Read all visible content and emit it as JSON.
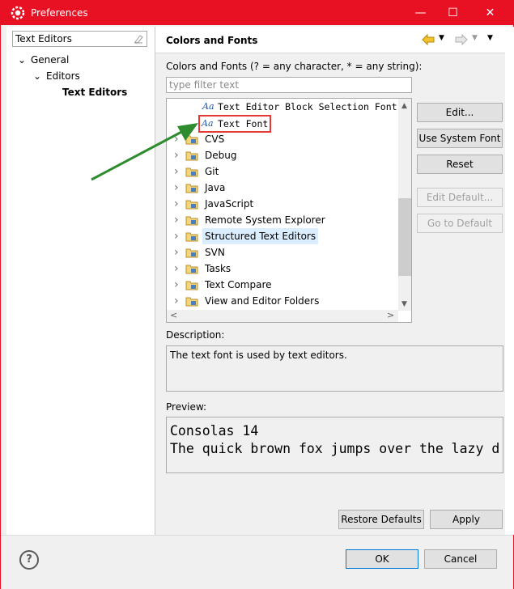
{
  "window": {
    "title": "Preferences",
    "accent": "#e81123"
  },
  "left": {
    "filter_value": "Text Editors",
    "tree": [
      {
        "label": "General",
        "level": 0,
        "expanded": true
      },
      {
        "label": "Editors",
        "level": 1,
        "expanded": true
      },
      {
        "label": "Text Editors",
        "level": 2,
        "selected": true
      }
    ]
  },
  "page": {
    "title": "Colors and Fonts",
    "filter_label": "Colors and Fonts (? = any character, * = any string):",
    "filter_placeholder": "type filter text",
    "tree_items": [
      {
        "label": "Text Editor Block Selection Font",
        "type": "font"
      },
      {
        "label": "Text Font",
        "type": "font",
        "highlighted": true
      },
      {
        "label": "CVS",
        "type": "folder"
      },
      {
        "label": "Debug",
        "type": "folder"
      },
      {
        "label": "Git",
        "type": "folder"
      },
      {
        "label": "Java",
        "type": "folder"
      },
      {
        "label": "JavaScript",
        "type": "folder"
      },
      {
        "label": "Remote System Explorer",
        "type": "folder"
      },
      {
        "label": "Structured Text Editors",
        "type": "folder",
        "hovered": true
      },
      {
        "label": "SVN",
        "type": "folder"
      },
      {
        "label": "Tasks",
        "type": "folder"
      },
      {
        "label": "Text Compare",
        "type": "folder"
      },
      {
        "label": "View and Editor Folders",
        "type": "folder"
      }
    ],
    "buttons": {
      "edit": "Edit...",
      "use_system_font": "Use System Font",
      "reset": "Reset",
      "edit_default": "Edit Default...",
      "go_to_default": "Go to Default"
    },
    "description_label": "Description:",
    "description_text": "The text font is used by text editors.",
    "preview_label": "Preview:",
    "preview_line1": "Consolas 14",
    "preview_line2": "The quick brown fox jumps over the lazy d",
    "restore_defaults": "Restore Defaults",
    "apply": "Apply"
  },
  "footer": {
    "ok": "OK",
    "cancel": "Cancel"
  }
}
